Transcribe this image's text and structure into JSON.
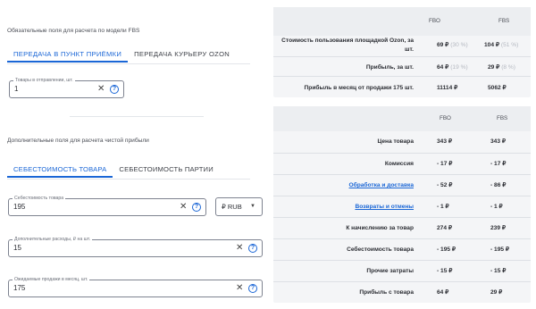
{
  "fbs_required": {
    "caption": "Обязательные поля для расчета по модели FBS",
    "tabs": [
      "ПЕРЕДАЧА В ПУНКТ ПРИЁМКИ",
      "ПЕРЕДАЧА КУРЬЕРУ OZON"
    ],
    "items_field": {
      "label": "Товары в отправлении, шт.",
      "value": "1"
    }
  },
  "profit_fields": {
    "caption": "Дополнительные поля для расчета чистой прибыли",
    "tabs": [
      "СЕБЕСТОИМОСТЬ ТОВАРА",
      "СЕБЕСТОИМОСТЬ ПАРТИИ"
    ],
    "cost_field": {
      "label": "Себестоимость товара",
      "value": "195"
    },
    "currency": "₽ RUB",
    "extra_field": {
      "label": "Дополнительные расходы, ₽ на шт.",
      "value": "15"
    },
    "sales_field": {
      "label": "Ожидаемые продажи в месяц, шт.",
      "value": "175"
    }
  },
  "summary": {
    "col_fbo": "FBO",
    "col_fbs": "FBS",
    "rows": [
      {
        "label_line1": "Стоимость пользования площадкой Ozon, за",
        "label_line2": "шт.",
        "fbo": "69 ₽",
        "fbo_pct": "(30 %)",
        "fbs": "104 ₽",
        "fbs_pct": "(51 %)"
      },
      {
        "label": "Прибыль, за шт.",
        "fbo": "64 ₽",
        "fbo_pct": "(19 %)",
        "fbs": "29 ₽",
        "fbs_pct": "(8 %)"
      },
      {
        "label": "Прибыль в месяц от продажи 175 шт.",
        "fbo": "11114 ₽",
        "fbs": "5062 ₽"
      }
    ]
  },
  "breakdown": {
    "col_fbo": "FBO",
    "col_fbs": "FBS",
    "rows": [
      {
        "label": "Цена товара",
        "fbo": "343 ₽",
        "fbs": "343 ₽",
        "link": false
      },
      {
        "label": "Комиссия",
        "fbo": "- 17 ₽",
        "fbs": "- 17 ₽",
        "link": false
      },
      {
        "label": "Обработка и доставка",
        "fbo": "- 52 ₽",
        "fbs": "- 86 ₽",
        "link": true
      },
      {
        "label": "Возвраты и отмены",
        "fbo": "- 1 ₽",
        "fbs": "- 1 ₽",
        "link": true
      },
      {
        "label": "К начислению за товар",
        "fbo": "274 ₽",
        "fbs": "239 ₽",
        "link": false
      },
      {
        "label": "Себестоимость товара",
        "fbo": "- 195 ₽",
        "fbs": "- 195 ₽",
        "link": false
      },
      {
        "label": "Прочие затраты",
        "fbo": "- 15 ₽",
        "fbs": "- 15 ₽",
        "link": false
      },
      {
        "label": "Прибыль с товара",
        "fbo": "64 ₽",
        "fbs": "29 ₽",
        "link": false
      }
    ]
  }
}
